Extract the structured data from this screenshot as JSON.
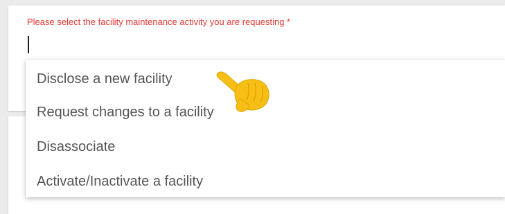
{
  "form": {
    "field_label": "Please select the facility maintenance activity you are requesting *",
    "input_value": ""
  },
  "dropdown": {
    "options": [
      {
        "label": "Disclose a new facility"
      },
      {
        "label": "Request changes to a facility"
      },
      {
        "label": "Disassociate"
      },
      {
        "label": "Activate/Inactivate a facility"
      }
    ]
  },
  "pointer": {
    "icon": "pointing-hand-icon",
    "color": "#F7BE16"
  },
  "colors": {
    "label_red": "#E53935",
    "option_text": "#555555"
  }
}
